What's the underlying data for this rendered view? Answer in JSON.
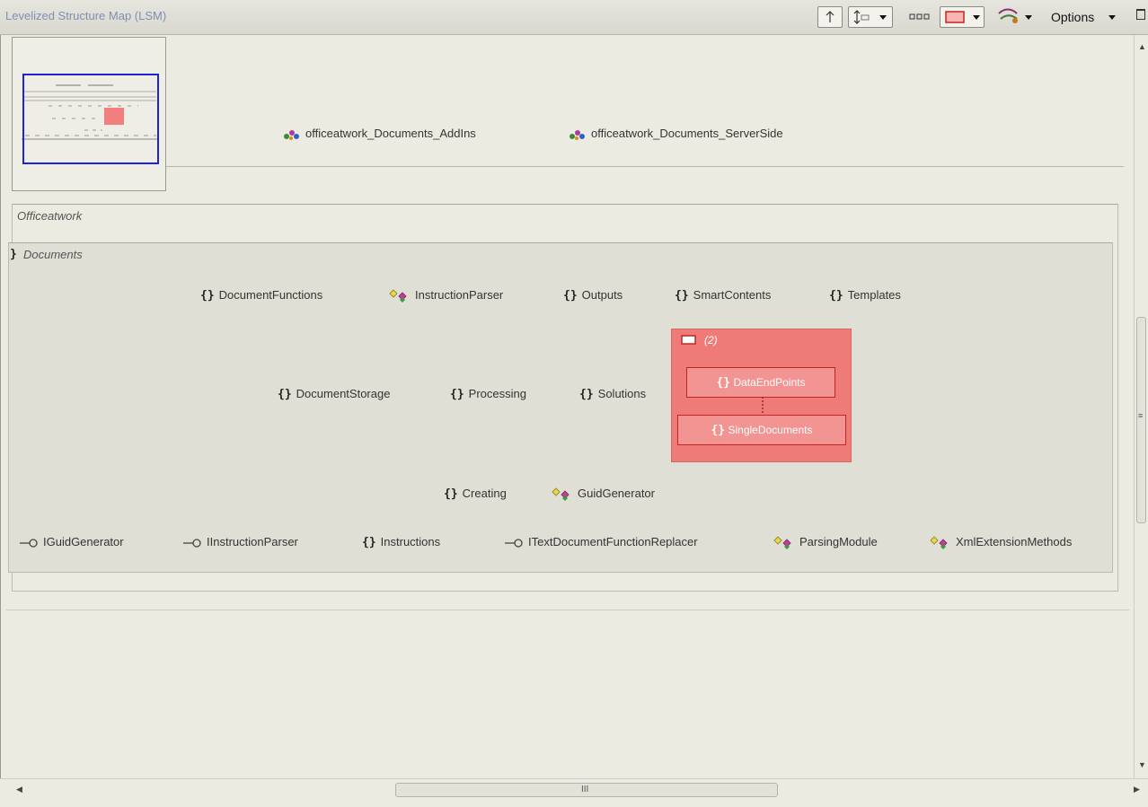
{
  "window": {
    "title": "Levelized Structure Map (LSM)",
    "options_label": "Options"
  },
  "assemblies": [
    {
      "label": "officeatwork_Documents_AddIns"
    },
    {
      "label": "officeatwork_Documents_ServerSide"
    }
  ],
  "groups": {
    "outer": "Officeatwork",
    "inner": "Documents"
  },
  "row1": [
    {
      "label": "DocumentFunctions"
    },
    {
      "label": "InstructionParser"
    },
    {
      "label": "Outputs"
    },
    {
      "label": "SmartContents"
    },
    {
      "label": "Templates"
    }
  ],
  "row2": [
    {
      "label": "DocumentStorage"
    },
    {
      "label": "Processing"
    },
    {
      "label": "Solutions"
    }
  ],
  "cycle": {
    "count_label": "(2)",
    "members": [
      {
        "label": "DataEndPoints"
      },
      {
        "label": "SingleDocuments"
      }
    ]
  },
  "row3": [
    {
      "label": "Creating"
    },
    {
      "label": "GuidGenerator"
    }
  ],
  "row4": [
    {
      "label": "IGuidGenerator"
    },
    {
      "label": "IInstructionParser"
    },
    {
      "label": "Instructions"
    },
    {
      "label": "ITextDocumentFunctionReplacer"
    },
    {
      "label": "ParsingModule"
    },
    {
      "label": "XmlExtensionMethods"
    }
  ],
  "icons": {
    "namespace": "{}",
    "class": "class-icon",
    "interface": "interface-icon",
    "assembly": "assembly-icon"
  },
  "colors": {
    "cycle_fill": "#ef7b78",
    "cycle_border": "#c62420",
    "minimap_viewport": "#1e23d6"
  },
  "scrollbar": {
    "grip": "III"
  }
}
